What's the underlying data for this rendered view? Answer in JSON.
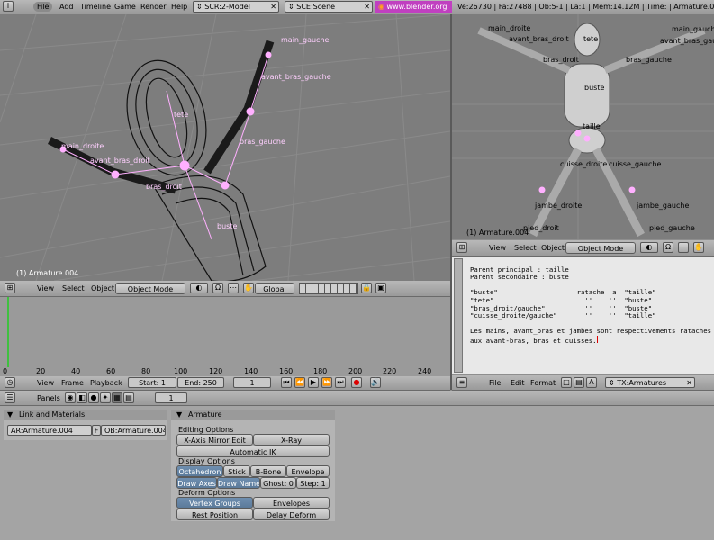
{
  "topbar": {
    "menus": [
      "File",
      "Add",
      "Timeline",
      "Game",
      "Render",
      "Help"
    ],
    "screen": "SCR:2-Model",
    "scene": "SCE:Scene",
    "url": "www.blender.org 241",
    "stats": "Ve:26730 | Fa:27488 | Ob:5-1 | La:1 | Mem:14.12M | Time: | Armature.004"
  },
  "viewport_left": {
    "object_label": "(1) Armature.004",
    "bones": {
      "main_gauche": "main_gauche",
      "avant_bras_gauche": "avant_bras_gauche",
      "tete": "tete",
      "bras_gauche": "bras_gauche",
      "main_droite": "main_droite",
      "avant_bras_droit": "avant_bras_droit",
      "bras_droit": "bras_droit",
      "buste": "buste"
    }
  },
  "viewport_right": {
    "object_label": "(1) Armature.004",
    "bones": {
      "main_droite": "main_droite",
      "main_gauche": "main_gauche",
      "avant_bras_droit": "avant_bras_droit",
      "tete": "tete",
      "avant_bras_gauche": "avant_bras_gauche",
      "bras_droit": "bras_droit",
      "bras_gauche": "bras_gauche",
      "buste": "buste",
      "taille": "taille",
      "cuisse_droite": "cuisse_droite",
      "cuisse_gauche": "cuisse_gauche",
      "jambe_droite": "jambe_droite",
      "jambe_gauche": "jambe_gauche",
      "pied_droit": "pied_droit",
      "pied_gauche": "pied_gauche"
    }
  },
  "header3d_left": {
    "view": "View",
    "select": "Select",
    "object": "Object",
    "mode": "Object Mode",
    "orientation": "Global"
  },
  "header3d_right": {
    "view": "View",
    "select": "Select",
    "object": "Object",
    "mode": "Object Mode"
  },
  "timeline": {
    "ticks": [
      "0",
      "20",
      "40",
      "60",
      "80",
      "100",
      "120",
      "140",
      "160",
      "180",
      "200",
      "220",
      "240"
    ],
    "view": "View",
    "frame": "Frame",
    "playback": "Playback",
    "start": "Start: 1",
    "end": "End: 250",
    "current": "1"
  },
  "text_editor": {
    "lines": [
      "Parent principal : taille",
      "Parent secondaire : buste",
      "",
      "\"buste\"                    ratache  a  \"taille\"",
      "\"tete\"                       ''    ''  \"buste\"",
      "\"bras_droit/gauche\"          ''    ''  \"buste\"",
      "\"cuisse_droite/gauche\"       ''    ''  \"taille\"",
      "",
      "Les mains, avant_bras et jambes sont respectivements rataches",
      "aux avant-bras, bras et cuisses."
    ],
    "file": "File",
    "edit": "Edit",
    "format": "Format",
    "textname": "TX:Armatures"
  },
  "buttons_header": {
    "panels": "Panels",
    "frame": "1"
  },
  "link_panel": {
    "title": "Link and Materials",
    "armature": "AR:Armature.004",
    "f": "F",
    "object": "OB:Armature.004"
  },
  "armature_panel": {
    "title": "Armature",
    "editing_title": "Editing Options",
    "x_axis_mirror": "X-Axis Mirror Edit",
    "x_ray": "X-Ray",
    "auto_ik": "Automatic IK",
    "display_title": "Display Options",
    "octahedron": "Octahedron",
    "stick": "Stick",
    "bbone": "B-Bone",
    "envelope": "Envelope",
    "draw_axes": "Draw Axes",
    "draw_names": "Draw Names",
    "ghost": "Ghost: 0",
    "step": "Step: 1",
    "deform_title": "Deform Options",
    "vertex_groups": "Vertex Groups",
    "envelopes": "Envelopes",
    "rest_position": "Rest Position",
    "delay_deform": "Delay Deform"
  }
}
